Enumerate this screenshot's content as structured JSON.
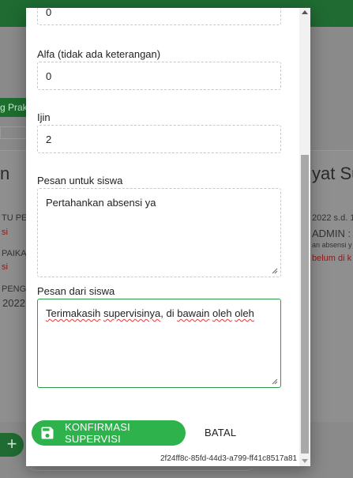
{
  "background": {
    "tab_label": "g Prak",
    "left_title": "n",
    "right_title": "yat Su",
    "left_lines": [
      "TU PE",
      "si",
      "PAIKA",
      "si",
      "PENG",
      "2022"
    ],
    "right_lines": [
      "2022 s.d. 1",
      "ADMIN :",
      "an absensi y",
      "belum di k"
    ],
    "fab_label": "+"
  },
  "form": {
    "top_value": "0",
    "alfa": {
      "label": "Alfa (tidak ada keterangan)",
      "value": "0"
    },
    "ijin": {
      "label": "Ijin",
      "value": "2"
    },
    "pesan_untuk": {
      "label": "Pesan untuk siswa",
      "value": "Pertahankan absensi ya"
    },
    "pesan_dari": {
      "label": "Pesan dari siswa",
      "words": [
        "Terimakasih",
        " ",
        "supervisinya",
        ", di ",
        "bawain",
        " ",
        "oleh",
        " ",
        "oleh"
      ]
    }
  },
  "actions": {
    "confirm_label": "KONFIRMASI SUPERVISI",
    "cancel_label": "BATAL"
  },
  "session_id": "2f24ff8c-85fd-44d3-a799-ff41c8517a81",
  "colors": {
    "primary": "#2eb24c",
    "dark_green": "#1f6b32"
  }
}
